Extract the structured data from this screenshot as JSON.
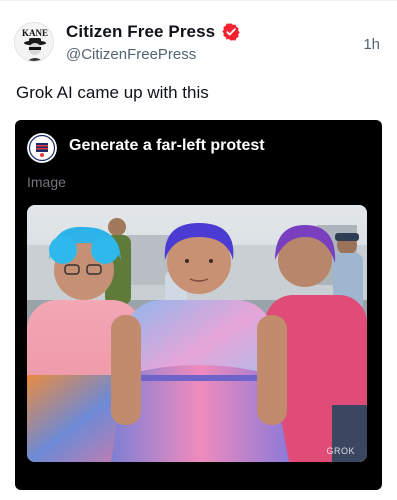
{
  "post": {
    "author": {
      "display_name": "Citizen Free Press",
      "handle": "@CitizenFreePress",
      "avatar_text": "KANE",
      "verified_color": "#f4212e"
    },
    "timestamp": "1h",
    "text": "Grok AI came up with this"
  },
  "media": {
    "prompt": "Generate a far-left protest",
    "type_label": "Image",
    "watermark": "GROK",
    "colors": {
      "card_bg": "#000000",
      "muted_text": "#71767b"
    }
  },
  "colors": {
    "text_primary": "#0f1419",
    "text_secondary": "#536471"
  }
}
